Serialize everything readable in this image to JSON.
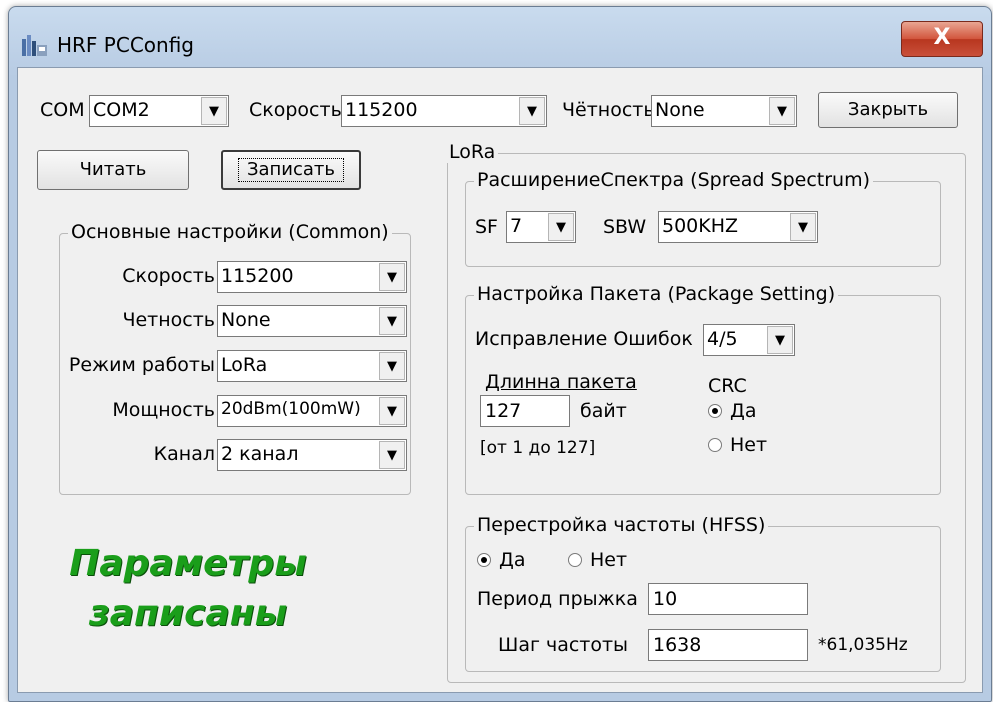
{
  "window": {
    "title": "HRF PCConfig",
    "close_glyph": "X",
    "icon": "app-icon"
  },
  "top_bar": {
    "com_label": "COM",
    "com_value": "COM2",
    "speed_label": "Скорость",
    "speed_value": "115200",
    "parity_label": "Чётность",
    "parity_value": "None",
    "close_button": "Закрыть"
  },
  "actions": {
    "read_button": "Читать",
    "write_button": "Записать"
  },
  "common": {
    "title": "Основные настройки (Common)",
    "speed_label": "Скорость",
    "speed_value": "115200",
    "parity_label": "Четность",
    "parity_value": "None",
    "mode_label": "Режим работы",
    "mode_value": "LoRa",
    "power_label": "Мощность",
    "power_value": "20dBm(100mW)",
    "channel_label": "Канал",
    "channel_value": "2 канал"
  },
  "status_message": {
    "line1": "Параметры",
    "line2": "записаны",
    "color": "#1a9e1a"
  },
  "lora": {
    "title": "LoRa",
    "spread": {
      "title": "РасширениеСпектра (Spread Spectrum)",
      "sf_label": "SF",
      "sf_value": "7",
      "sbw_label": "SBW",
      "sbw_value": "500KHZ"
    },
    "package": {
      "title": "Настройка Пакета (Package Setting)",
      "fec_label": "Исправление Ошибок",
      "fec_value": "4/5",
      "length_label": "Длинна пакета",
      "length_value": "127",
      "length_unit": "байт",
      "length_range": "[от 1 до 127]",
      "crc_label": "CRC",
      "crc_yes": "Да",
      "crc_no": "Нет",
      "crc_selected": "yes"
    },
    "hfss": {
      "title": "Перестройка частоты (HFSS)",
      "yes": "Да",
      "no": "Нет",
      "selected": "yes",
      "hop_period_label": "Период прыжка",
      "hop_period_value": "10",
      "freq_step_label": "Шаг частоты",
      "freq_step_value": "1638",
      "freq_step_unit": "*61,035Hz"
    }
  }
}
